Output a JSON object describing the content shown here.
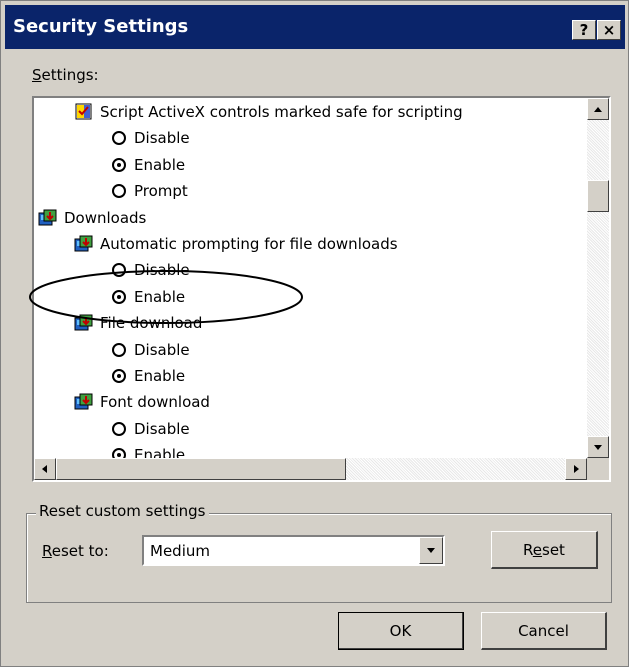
{
  "window": {
    "title": "Security Settings",
    "help_label": "?",
    "close_label": "×"
  },
  "settings_label": {
    "mnemonic": "S",
    "rest": "ettings:"
  },
  "items": [
    {
      "type": "group",
      "icon": "activex-icon",
      "label": "Script ActiveX controls marked safe for scripting"
    },
    {
      "type": "radio",
      "label": "Disable",
      "checked": false
    },
    {
      "type": "radio",
      "label": "Enable",
      "checked": true
    },
    {
      "type": "radio",
      "label": "Prompt",
      "checked": false
    },
    {
      "type": "category",
      "icon": "downloads-icon",
      "label": "Downloads"
    },
    {
      "type": "group",
      "icon": "downloads-icon",
      "label": "Automatic prompting for file downloads"
    },
    {
      "type": "radio",
      "label": "Disable",
      "checked": false
    },
    {
      "type": "radio",
      "label": "Enable",
      "checked": true
    },
    {
      "type": "group",
      "icon": "downloads-icon",
      "label": "File download"
    },
    {
      "type": "radio",
      "label": "Disable",
      "checked": false
    },
    {
      "type": "radio",
      "label": "Enable",
      "checked": true
    },
    {
      "type": "group",
      "icon": "downloads-icon",
      "label": "Font download"
    },
    {
      "type": "radio",
      "label": "Disable",
      "checked": false
    },
    {
      "type": "radio",
      "label": "Enable",
      "checked": true
    }
  ],
  "reset_group": {
    "title": "Reset custom settings",
    "reset_to_label": {
      "mnemonic": "R",
      "rest": "eset to:"
    },
    "reset_to_value": "Medium",
    "reset_button": {
      "pre": "R",
      "mnemonic": "e",
      "rest": "set"
    }
  },
  "buttons": {
    "ok": "OK",
    "cancel": "Cancel"
  },
  "colors": {
    "titlebar": "#0a246a",
    "dialog_face": "#d4d0c8",
    "annotation_ellipse": "#000000"
  }
}
